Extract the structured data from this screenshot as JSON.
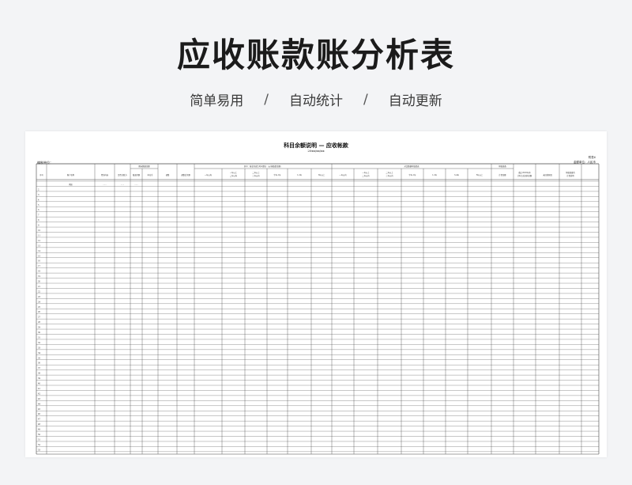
{
  "hero": {
    "title": "应收账款账分析表"
  },
  "tagline": {
    "items": [
      "简单易用",
      "自动统计",
      "自动更新"
    ],
    "separator": "/"
  },
  "document": {
    "title": "科目余额说明 — 应收帐款",
    "date": "20xx/xx/xx",
    "note_right_top": "附表6",
    "note_right_bottom": "金额单位：人民币",
    "note_left": "编制单位：",
    "header_groups": [
      "期末数据金额",
      "其中：按业务发生时间划分（元/按账龄金额）",
      "对比数据时账龄表",
      "坏账准备"
    ],
    "headers": [
      "序号",
      "客户名称",
      "经济内容",
      "是否关联方",
      "账面余额",
      "本位币",
      "调整",
      "调整后余额",
      "一年以内",
      "一年以上二年以内",
      "二年以上三年以内",
      "半年-1年",
      "1-2年",
      "3年以上",
      "一年以内",
      "一年以上二年以内",
      "二年以上三年以内",
      "半年-1年",
      "1-2年",
      "3-4年",
      "5年以上",
      "计提金额",
      "截止2020年审计时点后回款金额",
      "未回款原因",
      "坏账准备的计提说明"
    ],
    "first_row": [
      "",
      "例如",
      "······",
      "······",
      "······"
    ],
    "row_count": 55
  }
}
